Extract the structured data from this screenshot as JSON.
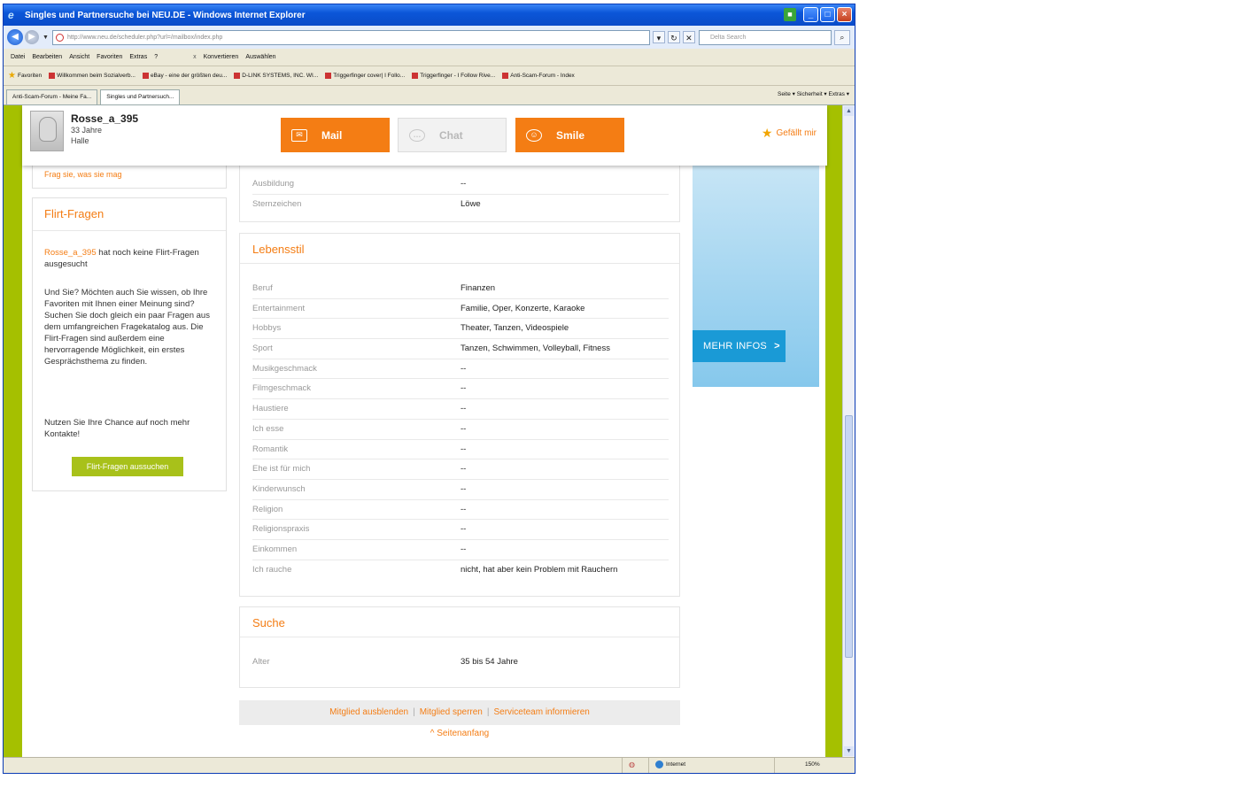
{
  "window": {
    "title": "Singles und Partnersuche bei NEU.DE - Windows Internet Explorer"
  },
  "addressbar": {
    "url": "http://www.neu.de/scheduler.php?url=/mailbox/index.php",
    "search_placeholder": "Delta Search"
  },
  "menubar": {
    "items": [
      "Datei",
      "Bearbeiten",
      "Ansicht",
      "Favoriten",
      "Extras",
      "?"
    ],
    "tools": [
      "Konvertieren",
      "Auswählen"
    ]
  },
  "favorites": {
    "label": "Favoriten",
    "items": [
      "Willkommen beim Sozialverb...",
      "eBay - eine der größten deu...",
      "D-LINK SYSTEMS, INC. WI...",
      "Triggerfinger cover| I Follo...",
      "Triggerfinger - I Follow Rive...",
      "Anti-Scam-Forum - Index"
    ]
  },
  "tabs": {
    "items": [
      "Anti-Scam-Forum - Meine Fa...",
      "Singles und Partnersuch..."
    ],
    "commands": "Seite ▾  Sicherheit ▾  Extras ▾"
  },
  "profile": {
    "name": "Rosse_a_395",
    "age": "33 Jahre",
    "city": "Halle",
    "mail_label": "Mail",
    "chat_label": "Chat",
    "smile_label": "Smile",
    "like_label": "Gefällt mir"
  },
  "sidebar": {
    "ask_link": "Frag sie, was sie mag",
    "flirt_title": "Flirt-Fragen",
    "flirt_user": "Rosse_a_395",
    "flirt_p1_rest": " hat noch keine Flirt-Fragen ausgesucht",
    "flirt_p2": "Und Sie? Möchten auch Sie wissen, ob Ihre Favoriten mit Ihnen einer Meinung sind? Suchen Sie doch gleich ein paar Fragen aus dem umfangreichen Fragekatalog aus. Die Flirt-Fragen sind außerdem eine hervorragende Möglichkeit, ein erstes Gesprächsthema zu finden.",
    "flirt_p3": "Nutzen Sie Ihre Chance auf noch mehr Kontakte!",
    "flirt_button": "Flirt-Fragen aussuchen"
  },
  "details_top": {
    "rows": [
      {
        "label": "Ausbildung",
        "value": "--"
      },
      {
        "label": "Sternzeichen",
        "value": "Löwe"
      }
    ]
  },
  "lifestyle": {
    "title": "Lebensstil",
    "rows": [
      {
        "label": "Beruf",
        "value": "Finanzen"
      },
      {
        "label": "Entertainment",
        "value": "Familie, Oper, Konzerte, Karaoke"
      },
      {
        "label": "Hobbys",
        "value": "Theater, Tanzen, Videospiele"
      },
      {
        "label": "Sport",
        "value": "Tanzen, Schwimmen, Volleyball, Fitness"
      },
      {
        "label": "Musikgeschmack",
        "value": "--"
      },
      {
        "label": "Filmgeschmack",
        "value": "--"
      },
      {
        "label": "Haustiere",
        "value": "--"
      },
      {
        "label": "Ich esse",
        "value": "--"
      },
      {
        "label": "Romantik",
        "value": "--"
      },
      {
        "label": "Ehe ist für mich",
        "value": "--"
      },
      {
        "label": "Kinderwunsch",
        "value": "--"
      },
      {
        "label": "Religion",
        "value": "--"
      },
      {
        "label": "Religionspraxis",
        "value": "--"
      },
      {
        "label": "Einkommen",
        "value": "--"
      },
      {
        "label": "Ich rauche",
        "value": "nicht, hat aber kein Problem mit Rauchern"
      }
    ]
  },
  "search": {
    "title": "Suche",
    "rows": [
      {
        "label": "Alter",
        "value": "35 bis 54 Jahre"
      }
    ]
  },
  "footer": {
    "hide_member": "Mitglied ausblenden",
    "block_member": "Mitglied sperren",
    "inform_team": "Serviceteam informieren",
    "page_top": "^ Seitenanfang"
  },
  "ad": {
    "button_label": "MEHR INFOS"
  },
  "statusbar": {
    "zone": "Internet",
    "zoom": "150%"
  },
  "colors": {
    "accent": "#f47d14",
    "page_background": "#a5c000",
    "ad_blue": "#1a9ad6",
    "flirt_button": "#a8c11a"
  }
}
